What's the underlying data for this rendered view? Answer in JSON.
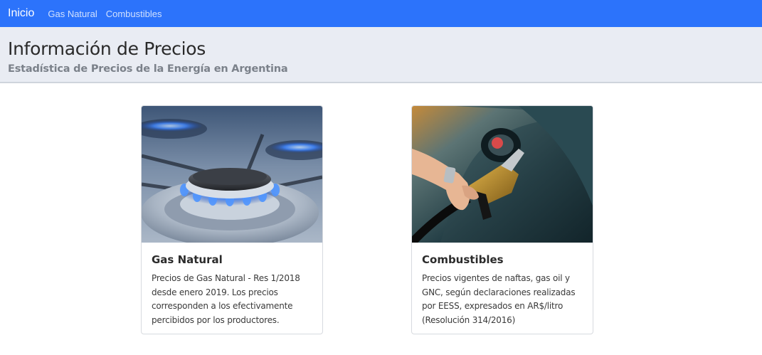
{
  "navbar": {
    "brand": "Inicio",
    "links": [
      "Gas Natural",
      "Combustibles"
    ]
  },
  "header": {
    "title": "Información de Precios",
    "subtitle": "Estadística de Precios de la Energía en Argentina"
  },
  "cards": [
    {
      "title": "Gas Natural",
      "text": "Precios de Gas Natural - Res 1/2018 desde enero 2019. Los precios corresponden a los efectivamente percibidos por los productores.",
      "image": "gas-stove-burner-flame"
    },
    {
      "title": "Combustibles",
      "text": "Precios vigentes de naftas, gas oil y GNC, según declaraciones realizadas por EESS, expresados en AR$/litro (Resolución 314/2016)",
      "image": "fuel-nozzle-refueling-car"
    }
  ],
  "colors": {
    "navbar": "#2c73fb",
    "header_bg": "#e9ecf3",
    "subtitle": "#7b818a"
  }
}
